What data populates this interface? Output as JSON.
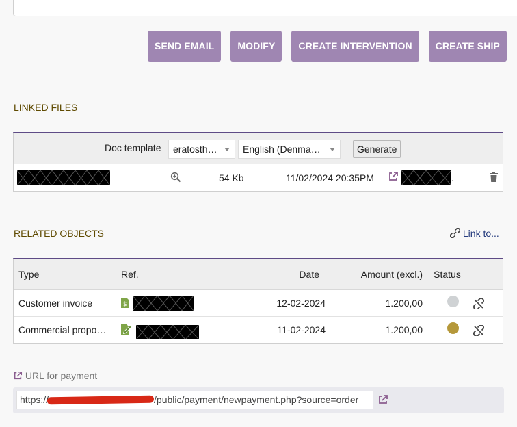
{
  "toolbar": {
    "send_email": "SEND EMAIL",
    "modify": "MODIFY",
    "create_intervention": "CREATE INTERVENTION",
    "create_shipment": "CREATE SHIP"
  },
  "linked_files": {
    "title": "LINKED FILES",
    "doc_template_label": "Doc template",
    "template_value": "eratosth…",
    "language_value": "English (Denma…",
    "generate_label": "Generate",
    "file": {
      "size": "54 Kb",
      "date": "11/02/2024 20:35PM",
      "suffix": "."
    }
  },
  "related_objects": {
    "title": "RELATED OBJECTS",
    "link_to_label": "Link to...",
    "columns": [
      "Type",
      "Ref.",
      "Date",
      "Amount (excl.)",
      "Status"
    ],
    "rows": [
      {
        "type": "Customer invoice",
        "date": "12-02-2024",
        "amount": "1.200,00",
        "status_color": "#cfd2d4"
      },
      {
        "type": "Commercial propo…",
        "date": "11-02-2024",
        "amount": "1.200,00",
        "status_color": "#b5983a"
      }
    ]
  },
  "payment": {
    "label": "URL for payment",
    "url_prefix": "https://",
    "url_suffix": "/public/payment/newpayment.php?source=order"
  },
  "colors": {
    "accent": "#9f86b2",
    "section_title": "#5f4a00",
    "panel_border": "#5e4b86",
    "link": "#263c7e",
    "file_icon_green": "#7fa548",
    "redaction": "#d82816"
  },
  "icons": [
    "zoom-icon",
    "external-link-icon",
    "trash-icon",
    "link-icon",
    "unlink-icon",
    "invoice-file-icon",
    "proposal-file-icon"
  ]
}
